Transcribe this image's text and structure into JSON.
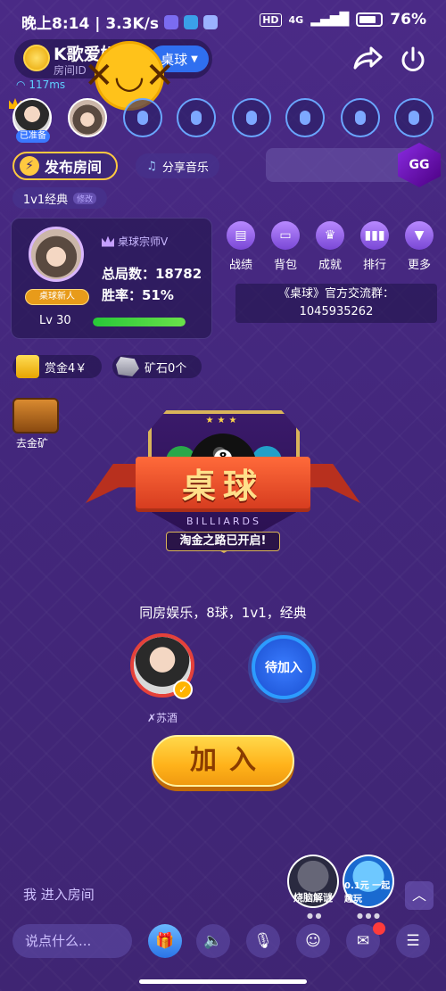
{
  "status_bar": {
    "time_speed": "晚上8:14 | 3.3K/s",
    "network": "4G",
    "battery": "76%"
  },
  "header": {
    "room_name": "K歌爱好",
    "room_id_label": "房间ID",
    "game_label": "桌球",
    "latency": "117ms"
  },
  "seats": {
    "ready_badge": "已准备"
  },
  "actions": {
    "publish_label": "发布房间",
    "share_music_label": "分享音乐",
    "mode_label": "1v1经典",
    "mode_edit": "修改"
  },
  "player": {
    "badge": "桌球新人",
    "level": "Lv 30",
    "rank": "桌球宗师V",
    "total_games": "总局数：18782",
    "win_rate": "胜率：51%",
    "level_progress": 1.0
  },
  "menu": {
    "items": [
      "战绩",
      "背包",
      "成就",
      "排行",
      "更多"
    ]
  },
  "group": {
    "line1": "《桌球》官方交流群：",
    "line2": "1045935262"
  },
  "currency": {
    "gold": "赏金4￥",
    "ore": "矿石0个",
    "mine": "去金矿"
  },
  "emblem": {
    "title": "桌球",
    "subtitle": "BILLIARDS",
    "ball_number": "8",
    "slogan": "淘金之路已开启!"
  },
  "room_desc": "同房娱乐，8球，1v1，经典",
  "players": {
    "p1_name": "✗苏酒",
    "p2_label": "待加入"
  },
  "join_label": "加入",
  "bottom": {
    "enter_msg": "我  进入房间",
    "float1_label": "烧脑解谜",
    "float2_label": "0.1元 一起趣玩",
    "chat_placeholder": "说点什么..."
  },
  "colors": {
    "background": "#4a2a86",
    "accent_gold": "#ffc940",
    "accent_blue": "#2f6ff0",
    "danger": "#e5413a"
  }
}
